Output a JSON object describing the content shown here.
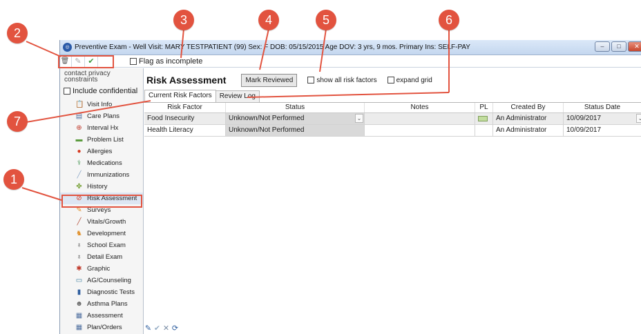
{
  "window": {
    "title": "Preventive Exam - Well Visit:  MARY TESTPATIENT (99)  Sex: F  DOB: 05/15/2015  Age DOV: 3 yrs, 9 mos.  Primary Ins: SELF-PAY",
    "controls": {
      "minimize": "‒",
      "maximize": "□",
      "close": "✕"
    }
  },
  "toolbar": {
    "icons": [
      "trash-icon",
      "pencil-icon",
      "checkmark-icon"
    ],
    "icon_glyphs": [
      "🗑",
      "✎",
      "✔"
    ],
    "flag_label": "Flag as incomplete"
  },
  "sidebar": {
    "privacy_text": "contact privacy constraints",
    "include_confidential_label": "Include confidential",
    "items": [
      {
        "label": "Visit Info",
        "icon": "visit-info-icon",
        "glyph": "📋",
        "color": "#6b7b8c"
      },
      {
        "label": "Care Plans",
        "icon": "care-plans-icon",
        "glyph": "▤",
        "color": "#4f6f9f"
      },
      {
        "label": "Interval Hx",
        "icon": "interval-hx-icon",
        "glyph": "⊕",
        "color": "#c0392b"
      },
      {
        "label": "Problem List",
        "icon": "problem-list-icon",
        "glyph": "▬",
        "color": "#5b9b3d"
      },
      {
        "label": "Allergies",
        "icon": "allergies-icon",
        "glyph": "●",
        "color": "#d6391f"
      },
      {
        "label": "Medications",
        "icon": "medications-icon",
        "glyph": "⚕",
        "color": "#3b8f4a"
      },
      {
        "label": "Immunizations",
        "icon": "immunizations-icon",
        "glyph": "╱",
        "color": "#8ca7c8"
      },
      {
        "label": "History",
        "icon": "history-icon",
        "glyph": "✤",
        "color": "#7aa33b"
      },
      {
        "label": "Risk Assessment",
        "icon": "risk-assessment-icon",
        "glyph": "⊘",
        "color": "#d6391f"
      },
      {
        "label": "Surveys",
        "icon": "surveys-icon",
        "glyph": "✎",
        "color": "#e0902c"
      },
      {
        "label": "Vitals/Growth",
        "icon": "vitals-growth-icon",
        "glyph": "╱",
        "color": "#b5533f"
      },
      {
        "label": "Development",
        "icon": "development-icon",
        "glyph": "♞",
        "color": "#e0902c"
      },
      {
        "label": "School Exam",
        "icon": "school-exam-icon",
        "glyph": "♁",
        "color": "#333333"
      },
      {
        "label": "Detail Exam",
        "icon": "detail-exam-icon",
        "glyph": "♁",
        "color": "#333333"
      },
      {
        "label": "Graphic",
        "icon": "graphic-icon",
        "glyph": "✱",
        "color": "#c0392b"
      },
      {
        "label": "AG/Counseling",
        "icon": "ag-counseling-icon",
        "glyph": "▭",
        "color": "#3f7f9f"
      },
      {
        "label": "Diagnostic Tests",
        "icon": "diagnostic-tests-icon",
        "glyph": "▮",
        "color": "#2f5f9f"
      },
      {
        "label": "Asthma Plans",
        "icon": "asthma-plans-icon",
        "glyph": "☻",
        "color": "#6a6a6a"
      },
      {
        "label": "Assessment",
        "icon": "assessment-icon",
        "glyph": "▦",
        "color": "#4f6f9f"
      },
      {
        "label": "Plan/Orders",
        "icon": "plan-orders-icon",
        "glyph": "▦",
        "color": "#4f6f9f"
      }
    ],
    "selected_index": 8
  },
  "main": {
    "title": "Risk Assessment",
    "mark_reviewed_label": "Mark Reviewed",
    "show_all_label": "show all risk factors",
    "expand_grid_label": "expand grid",
    "tabs": [
      {
        "label": "Current Risk Factors",
        "active": true
      },
      {
        "label": "Review Log",
        "active": false
      }
    ],
    "grid": {
      "columns": [
        "Risk Factor",
        "Status",
        "Notes",
        "PL",
        "Created By",
        "Status Date"
      ],
      "rows": [
        {
          "risk_factor": "Food Insecurity",
          "status": "Unknown/Not Performed",
          "notes": "",
          "created_by": "An Administrator",
          "status_date": "10/09/2017"
        },
        {
          "risk_factor": "Health Literacy",
          "status": "Unknown/Not Performed",
          "notes": "",
          "created_by": "An Administrator",
          "status_date": "10/09/2017"
        }
      ]
    },
    "bottom_tools": [
      {
        "icon": "edit-pencil-icon",
        "glyph": "✎",
        "color": "#2f5f9f"
      },
      {
        "icon": "confirm-check-icon",
        "glyph": "✔",
        "color": "#9ab0c8"
      },
      {
        "icon": "delete-x-icon",
        "glyph": "✕",
        "color": "#7a8ea6"
      },
      {
        "icon": "refresh-icon",
        "glyph": "⟳",
        "color": "#2f5f9f"
      }
    ]
  },
  "callouts": [
    "1",
    "2",
    "3",
    "4",
    "5",
    "6",
    "7"
  ],
  "colors": {
    "callout": "#e2533f",
    "accent": "#2a5aa8"
  }
}
